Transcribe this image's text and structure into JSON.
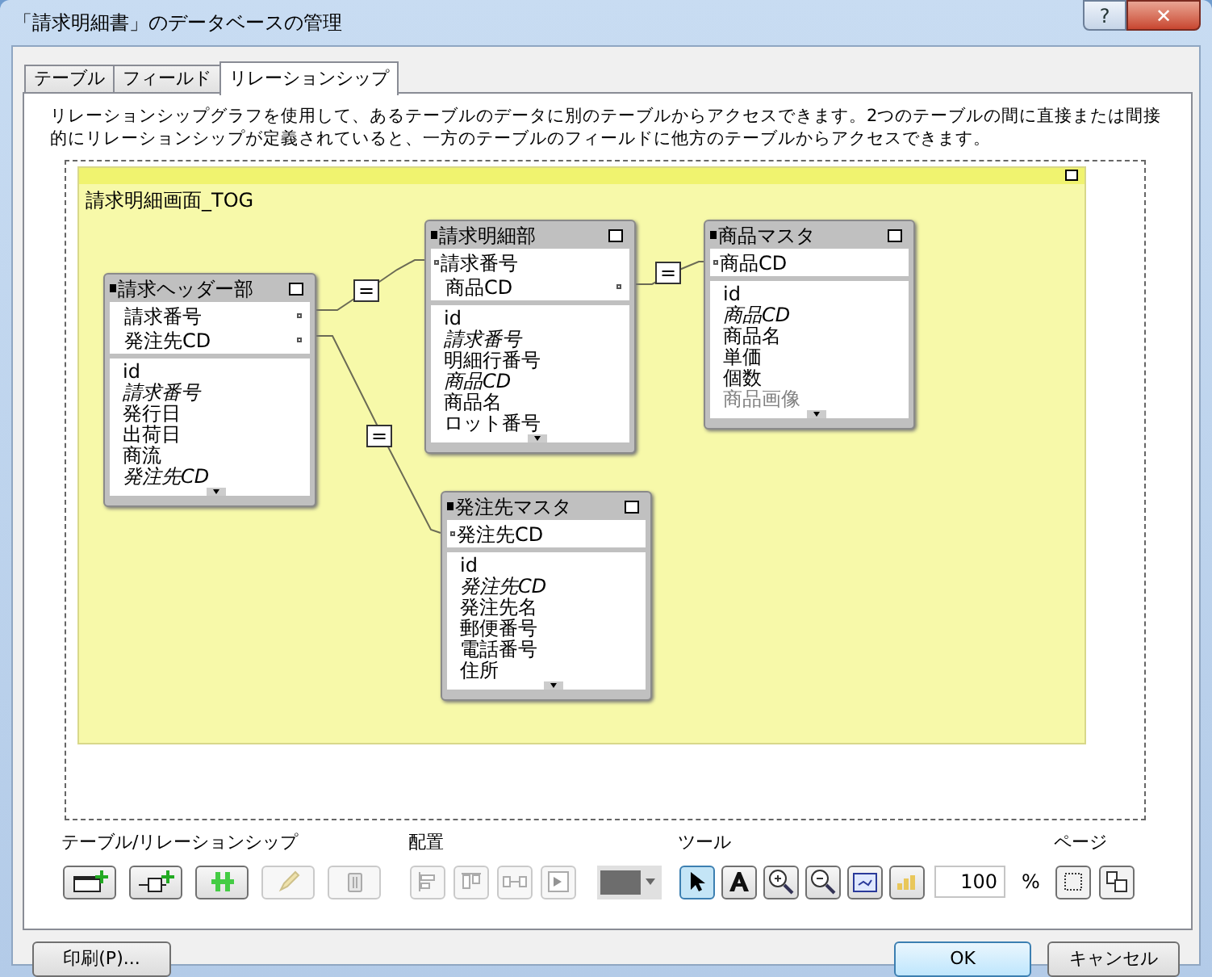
{
  "window": {
    "title": "「請求明細書」のデータベースの管理",
    "help": "?",
    "close": "✕"
  },
  "tabs": [
    {
      "label": "テーブル",
      "selected": false
    },
    {
      "label": "フィールド",
      "selected": false
    },
    {
      "label": "リレーションシップ",
      "selected": true
    }
  ],
  "description": "リレーションシップグラフを使用して、あるテーブルのデータに別のテーブルからアクセスできます。2つのテーブルの間に直接または間接的にリレーションシップが定義されていると、一方のテーブルのフィールドに他方のテーブルからアクセスできます。",
  "group": {
    "title": "請求明細画面_TOG"
  },
  "tables": [
    {
      "name": "請求ヘッダー部",
      "keys": [
        {
          "text": "請求番号",
          "port_on_left": false
        },
        {
          "text": "発注先CD",
          "port_on_left": false
        }
      ],
      "fields": [
        {
          "text": "id",
          "italic": false,
          "dimmed": false
        },
        {
          "text": "請求番号",
          "italic": true,
          "dimmed": false
        },
        {
          "text": "発行日",
          "italic": false,
          "dimmed": false
        },
        {
          "text": "出荷日",
          "italic": false,
          "dimmed": false
        },
        {
          "text": "商流",
          "italic": false,
          "dimmed": false
        },
        {
          "text": "発注先CD",
          "italic": true,
          "dimmed": false
        }
      ]
    },
    {
      "name": "請求明細部",
      "keys": [
        {
          "text": "請求番号",
          "port_on_left": true
        },
        {
          "text": "商品CD",
          "port_on_left": false
        }
      ],
      "fields": [
        {
          "text": "id",
          "italic": false,
          "dimmed": false
        },
        {
          "text": "請求番号",
          "italic": true,
          "dimmed": false
        },
        {
          "text": "明細行番号",
          "italic": false,
          "dimmed": false
        },
        {
          "text": "商品CD",
          "italic": true,
          "dimmed": false
        },
        {
          "text": "商品名",
          "italic": false,
          "dimmed": false
        },
        {
          "text": "ロット番号",
          "italic": false,
          "dimmed": false
        }
      ]
    },
    {
      "name": "商品マスタ",
      "keys": [
        {
          "text": "商品CD",
          "port_on_left": true
        }
      ],
      "fields": [
        {
          "text": "id",
          "italic": false,
          "dimmed": false
        },
        {
          "text": "商品CD",
          "italic": true,
          "dimmed": false
        },
        {
          "text": "商品名",
          "italic": false,
          "dimmed": false
        },
        {
          "text": "単価",
          "italic": false,
          "dimmed": false
        },
        {
          "text": "個数",
          "italic": false,
          "dimmed": false
        },
        {
          "text": "商品画像",
          "italic": false,
          "dimmed": true
        }
      ]
    },
    {
      "name": "発注先マスタ",
      "keys": [
        {
          "text": "発注先CD",
          "port_on_left": true
        }
      ],
      "fields": [
        {
          "text": "id",
          "italic": false,
          "dimmed": false
        },
        {
          "text": "発注先CD",
          "italic": true,
          "dimmed": false
        },
        {
          "text": "発注先名",
          "italic": false,
          "dimmed": false
        },
        {
          "text": "郵便番号",
          "italic": false,
          "dimmed": false
        },
        {
          "text": "電話番号",
          "italic": false,
          "dimmed": false
        },
        {
          "text": "住所",
          "italic": false,
          "dimmed": false
        }
      ]
    }
  ],
  "relationships": [
    {
      "operator": "="
    },
    {
      "operator": "="
    },
    {
      "operator": "="
    }
  ],
  "toolbar": {
    "table_label": "テーブル/リレーションシップ",
    "arrange_label": "配置",
    "tools_label": "ツール",
    "page_label": "ページ",
    "table_buttons": [
      {
        "kind": "add-table",
        "disabled": false
      },
      {
        "kind": "add-relation",
        "disabled": false
      },
      {
        "kind": "duplicate",
        "disabled": false
      },
      {
        "kind": "edit",
        "disabled": true
      },
      {
        "kind": "delete",
        "disabled": true
      }
    ],
    "arrange_buttons": [
      {
        "kind": "align-left",
        "disabled": true
      },
      {
        "kind": "align-top",
        "disabled": true
      },
      {
        "kind": "distribute",
        "disabled": true
      },
      {
        "kind": "resize",
        "disabled": true
      }
    ],
    "tools": [
      {
        "kind": "pointer",
        "selected": true
      },
      {
        "kind": "text",
        "selected": false
      },
      {
        "kind": "zoom-in",
        "selected": false
      },
      {
        "kind": "zoom-out",
        "selected": false
      },
      {
        "kind": "fit",
        "selected": false
      },
      {
        "kind": "chart",
        "selected": false
      }
    ],
    "zoom": "100",
    "zoom_unit": "%"
  },
  "buttons": {
    "print": "印刷(P)...",
    "ok": "OK",
    "cancel": "キャンセル"
  }
}
